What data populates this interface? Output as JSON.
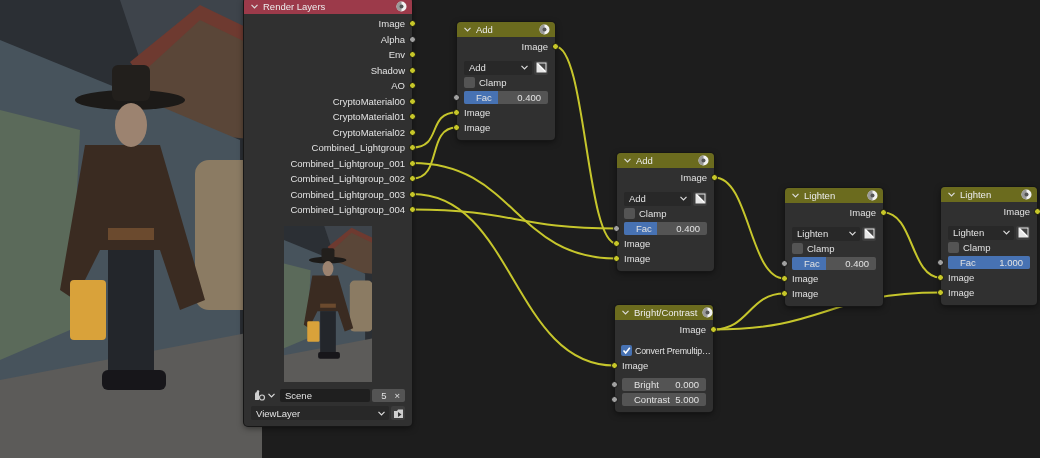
{
  "nodes": [
    {
      "kind": "render_layers",
      "title": "Render Layers",
      "outputs": [
        {
          "label": "Image",
          "kind": "color"
        },
        {
          "label": "Alpha",
          "kind": "value"
        },
        {
          "label": "Env",
          "kind": "color"
        },
        {
          "label": "Shadow",
          "kind": "color"
        },
        {
          "label": "AO",
          "kind": "color"
        },
        {
          "label": "CryptoMaterial00",
          "kind": "color"
        },
        {
          "label": "CryptoMaterial01",
          "kind": "color"
        },
        {
          "label": "CryptoMaterial02",
          "kind": "color"
        },
        {
          "label": "Combined_Lightgroup",
          "kind": "color"
        },
        {
          "label": "Combined_Lightgroup_001",
          "kind": "color"
        },
        {
          "label": "Combined_Lightgroup_002",
          "kind": "color"
        },
        {
          "label": "Combined_Lightgroup_003",
          "kind": "color"
        },
        {
          "label": "Combined_Lightgroup_004",
          "kind": "color"
        }
      ],
      "scene": {
        "value": "Scene",
        "users": "5",
        "clear": "×"
      },
      "view_layer": {
        "value": "ViewLayer"
      }
    },
    {
      "kind": "mix",
      "title": "Add",
      "outputs": [
        {
          "label": "Image",
          "kind": "color"
        }
      ],
      "blend": "Add",
      "clamp": {
        "label": "Clamp",
        "checked": false
      },
      "fac": {
        "label": "Fac",
        "value": "0.400",
        "level": 0.4,
        "kind": "value"
      },
      "inputs": [
        {
          "label": "Image",
          "kind": "color"
        },
        {
          "label": "Image",
          "kind": "color"
        }
      ]
    },
    {
      "kind": "mix",
      "title": "Add",
      "outputs": [
        {
          "label": "Image",
          "kind": "color"
        }
      ],
      "blend": "Add",
      "clamp": {
        "label": "Clamp",
        "checked": false
      },
      "fac": {
        "label": "Fac",
        "value": "0.400",
        "level": 0.4,
        "kind": "value"
      },
      "inputs": [
        {
          "label": "Image",
          "kind": "color"
        },
        {
          "label": "Image",
          "kind": "color"
        }
      ]
    },
    {
      "kind": "bright_contrast",
      "title": "Bright/Contrast",
      "outputs": [
        {
          "label": "Image",
          "kind": "color"
        }
      ],
      "premultiply": {
        "label": "Convert Premultip…",
        "checked": true
      },
      "inputs": [
        {
          "label": "Image",
          "kind": "color"
        },
        {
          "label": "Bright",
          "value": "0.000",
          "kind": "value"
        },
        {
          "label": "Contrast",
          "value": "5.000",
          "kind": "value"
        }
      ]
    },
    {
      "kind": "mix",
      "title": "Lighten",
      "outputs": [
        {
          "label": "Image",
          "kind": "color"
        }
      ],
      "blend": "Lighten",
      "clamp": {
        "label": "Clamp",
        "checked": false
      },
      "fac": {
        "label": "Fac",
        "value": "0.400",
        "level": 0.4,
        "kind": "value"
      },
      "inputs": [
        {
          "label": "Image",
          "kind": "color"
        },
        {
          "label": "Image",
          "kind": "color"
        }
      ]
    },
    {
      "kind": "mix",
      "title": "Lighten",
      "outputs": [
        {
          "label": "Image",
          "kind": "color"
        }
      ],
      "blend": "Lighten",
      "clamp": {
        "label": "Clamp",
        "checked": false
      },
      "fac": {
        "label": "Fac",
        "value": "1.000",
        "level": 1.0,
        "kind": "value"
      },
      "inputs": [
        {
          "label": "Image",
          "kind": "color"
        },
        {
          "label": "Image",
          "kind": "color"
        }
      ]
    }
  ]
}
